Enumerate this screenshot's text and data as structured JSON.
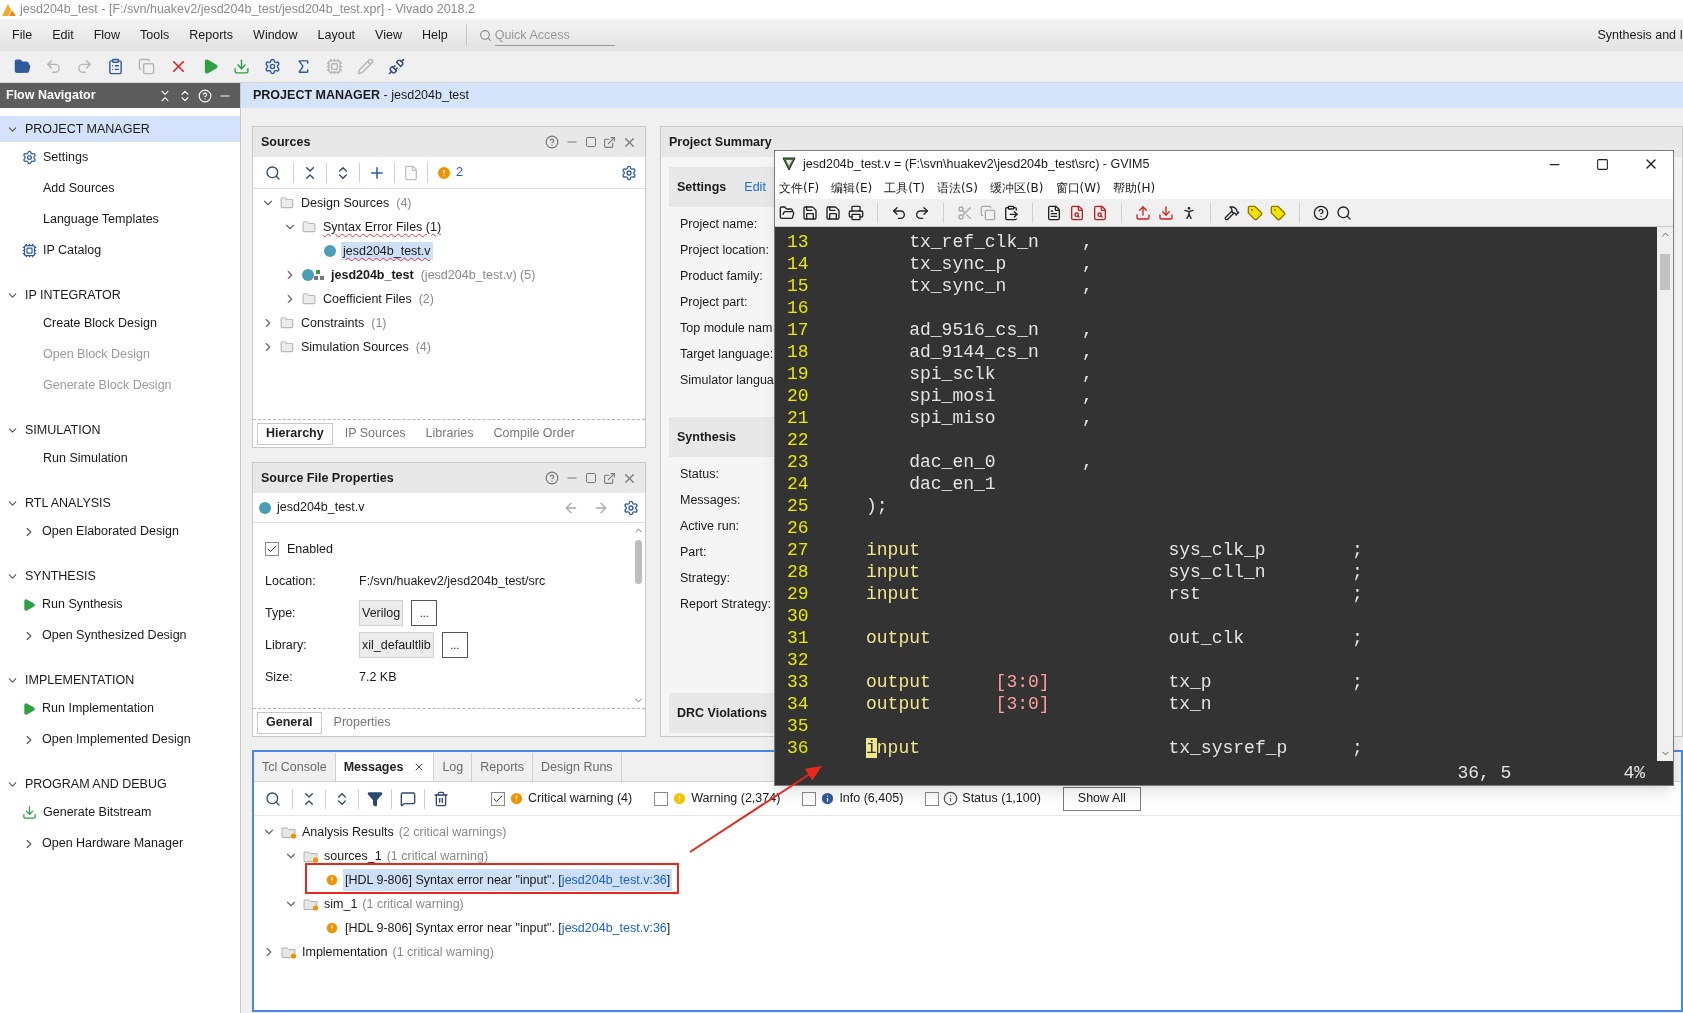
{
  "window": {
    "title": "jesd204b_test - [F:/svn/huakev2/jesd204b_test/jesd204b_test.xpr] - Vivado 2018.2"
  },
  "menu": [
    "File",
    "Edit",
    "Flow",
    "Tools",
    "Reports",
    "Window",
    "Layout",
    "View",
    "Help"
  ],
  "quick_access": {
    "placeholder": "Quick Access"
  },
  "layout_label": "Synthesis and I",
  "flow_navigator": {
    "title": "Flow Navigator",
    "sections": [
      {
        "title": "PROJECT MANAGER",
        "selected": true,
        "expanded": true,
        "items": [
          {
            "label": "Settings",
            "kind": "gear",
            "disabled": false
          },
          {
            "label": "Add Sources",
            "kind": "plain",
            "disabled": false
          },
          {
            "label": "Language Templates",
            "kind": "plain",
            "disabled": false
          },
          {
            "label": "IP Catalog",
            "kind": "catalog",
            "disabled": false
          }
        ]
      },
      {
        "title": "IP INTEGRATOR",
        "selected": false,
        "expanded": true,
        "items": [
          {
            "label": "Create Block Design",
            "kind": "plain",
            "disabled": false
          },
          {
            "label": "Open Block Design",
            "kind": "plain",
            "disabled": true
          },
          {
            "label": "Generate Block Design",
            "kind": "plain",
            "disabled": true
          }
        ]
      },
      {
        "title": "SIMULATION",
        "selected": false,
        "expanded": true,
        "items": [
          {
            "label": "Run Simulation",
            "kind": "plain",
            "disabled": false
          }
        ]
      },
      {
        "title": "RTL ANALYSIS",
        "selected": false,
        "expanded": true,
        "items": [
          {
            "label": "Open Elaborated Design",
            "kind": "expand",
            "disabled": false
          }
        ]
      },
      {
        "title": "SYNTHESIS",
        "selected": false,
        "expanded": true,
        "items": [
          {
            "label": "Run Synthesis",
            "kind": "run",
            "disabled": false
          },
          {
            "label": "Open Synthesized Design",
            "kind": "expand",
            "disabled": false
          }
        ]
      },
      {
        "title": "IMPLEMENTATION",
        "selected": false,
        "expanded": true,
        "items": [
          {
            "label": "Run Implementation",
            "kind": "run",
            "disabled": false
          },
          {
            "label": "Open Implemented Design",
            "kind": "expand",
            "disabled": false
          }
        ]
      },
      {
        "title": "PROGRAM AND DEBUG",
        "selected": false,
        "expanded": true,
        "items": [
          {
            "label": "Generate Bitstream",
            "kind": "bitstream",
            "disabled": false
          },
          {
            "label": "Open Hardware Manager",
            "kind": "expand",
            "disabled": false
          }
        ]
      }
    ]
  },
  "project_manager": {
    "heading": "**PROJECT MANAGER** - jesd204b_test"
  },
  "sources": {
    "title": "Sources",
    "warning_count": "2",
    "tree": [
      {
        "label": "Design Sources",
        "count": "(4)",
        "kind": "folder",
        "expanded": true,
        "selected": false,
        "children": [
          {
            "label": "Syntax Error Files (1)",
            "kind": "folder",
            "expanded": true,
            "selected": false,
            "error": true,
            "children": [
              {
                "label": "jesd204b_test.v",
                "kind": "file",
                "selected": true,
                "error": true
              }
            ]
          },
          {
            "label": "jesd204b_test",
            "detail": "(jesd204b_test.v) (5)",
            "kind": "module",
            "bold": true,
            "expanded": false,
            "selected": false
          },
          {
            "label": "Coefficient Files",
            "count": "(2)",
            "kind": "folder",
            "expanded": false,
            "selected": false
          }
        ]
      },
      {
        "label": "Constraints",
        "count": "(1)",
        "kind": "folder",
        "expanded": false,
        "selected": false
      },
      {
        "label": "Simulation Sources",
        "count": "(4)",
        "kind": "folder",
        "expanded": false,
        "selected": false
      }
    ],
    "tabs": [
      {
        "label": "Hierarchy",
        "selected": true
      },
      {
        "label": "IP Sources",
        "selected": false
      },
      {
        "label": "Libraries",
        "selected": false
      },
      {
        "label": "Compile Order",
        "selected": false
      }
    ]
  },
  "source_file_properties": {
    "title": "Source File Properties",
    "file": "jesd204b_test.v",
    "enabled": {
      "label": "Enabled",
      "checked": true
    },
    "rows": [
      {
        "kind": "text",
        "label": "Location:",
        "value": "F:/svn/huakev2/jesd204b_test/src"
      },
      {
        "kind": "field",
        "label": "Type:",
        "value": "Verilog",
        "button": "..."
      },
      {
        "kind": "field",
        "label": "Library:",
        "value": "xil_defaultlib",
        "button": "..."
      },
      {
        "kind": "text",
        "label": "Size:",
        "value": "7.2 KB"
      }
    ],
    "tabs": [
      {
        "label": "General",
        "selected": true
      },
      {
        "label": "Properties",
        "selected": false
      }
    ]
  },
  "project_summary": {
    "title": "Project Summary",
    "sections": [
      {
        "title": "Settings",
        "link": "Edit",
        "labels": [
          "Project name:",
          "Project location:",
          "Product family:",
          "Project part:",
          "Top module nam",
          "Target language:",
          "Simulator langua"
        ]
      },
      {
        "title": "Synthesis",
        "labels": [
          "Status:",
          "Messages:",
          "Active run:",
          "Part:",
          "Strategy:",
          "Report Strategy:"
        ]
      },
      {
        "title": "DRC Violations"
      }
    ]
  },
  "gvim": {
    "title": "jesd204b_test.v = (F:\\svn\\huakev2\\jesd204b_test\\src) - GVIM5",
    "menu": [
      "文件(F)",
      "编辑(E)",
      "工具(T)",
      "语法(S)",
      "缓冲区(B)",
      "窗口(W)",
      "帮助(H)"
    ],
    "lines": [
      {
        "number": "13",
        "kind": "signal",
        "signal": "tx_ref_clk_n",
        "punct": ","
      },
      {
        "number": "14",
        "kind": "signal",
        "signal": "tx_sync_p",
        "punct": ","
      },
      {
        "number": "15",
        "kind": "signal",
        "signal": "tx_sync_n",
        "punct": ","
      },
      {
        "number": "16",
        "kind": "blank"
      },
      {
        "number": "17",
        "kind": "signal",
        "signal": "ad_9516_cs_n",
        "punct": ","
      },
      {
        "number": "18",
        "kind": "signal",
        "signal": "ad_9144_cs_n",
        "punct": ","
      },
      {
        "number": "19",
        "kind": "signal",
        "signal": "spi_sclk",
        "punct": ","
      },
      {
        "number": "20",
        "kind": "signal",
        "signal": "spi_mosi",
        "punct": ","
      },
      {
        "number": "21",
        "kind": "signal",
        "signal": "spi_miso",
        "punct": ","
      },
      {
        "number": "22",
        "kind": "blank"
      },
      {
        "number": "23",
        "kind": "signal",
        "signal": "dac_en_0",
        "punct": ","
      },
      {
        "number": "24",
        "kind": "signal",
        "signal": "dac_en_1"
      },
      {
        "number": "25",
        "kind": "close",
        "text": ");"
      },
      {
        "number": "26",
        "kind": "blank"
      },
      {
        "number": "27",
        "kind": "port",
        "keyword": "input",
        "signal": "sys_clk_p",
        "punct": ";"
      },
      {
        "number": "28",
        "kind": "port",
        "keyword": "input",
        "signal": "sys_cll_n",
        "punct": ";"
      },
      {
        "number": "29",
        "kind": "port",
        "keyword": "input",
        "signal": "rst",
        "punct": ";"
      },
      {
        "number": "30",
        "kind": "blank"
      },
      {
        "number": "31",
        "kind": "port",
        "keyword": "output",
        "signal": "out_clk",
        "punct": ";"
      },
      {
        "number": "32",
        "kind": "blank"
      },
      {
        "number": "33",
        "kind": "port",
        "keyword": "output",
        "range": "[3:0]",
        "signal": "tx_p",
        "punct": ";"
      },
      {
        "number": "34",
        "kind": "port",
        "keyword": "output",
        "range": "[3:0]",
        "signal": "tx_n"
      },
      {
        "number": "35",
        "kind": "blank"
      },
      {
        "number": "36",
        "kind": "port",
        "keyword": "input",
        "signal": "tx_sysref_p",
        "punct": ";",
        "cursor": true
      }
    ],
    "position": "36, 5",
    "percent": "4%"
  },
  "messages": {
    "tabs": [
      {
        "label": "Tcl Console",
        "selected": false
      },
      {
        "label": "Messages",
        "selected": true,
        "closable": true
      },
      {
        "label": "Log",
        "selected": false
      },
      {
        "label": "Reports",
        "selected": false
      },
      {
        "label": "Design Runs",
        "selected": false
      }
    ],
    "filters": [
      {
        "label": "Critical warning (4)",
        "checked": true,
        "kind": "critical"
      },
      {
        "label": "Warning (2,374)",
        "checked": false,
        "kind": "warning"
      },
      {
        "label": "Info (6,405)",
        "checked": false,
        "kind": "info"
      },
      {
        "label": "Status (1,100)",
        "checked": false,
        "kind": "status"
      }
    ],
    "show_all": "Show All",
    "tree": [
      {
        "kind": "group",
        "label": "Analysis Results",
        "count": "(2 critical warnings)",
        "expanded": true,
        "selected": false,
        "children": [
          {
            "kind": "group",
            "label": "sources_1",
            "count": "(1 critical warning)",
            "expanded": true,
            "selected": false,
            "children": [
              {
                "kind": "message",
                "text_before": "[HDL 9-806] Syntax error near \"input\". [",
                "link": "jesd204b_test.v:36",
                "text_after": "]",
                "selected": true,
                "annotated": true
              }
            ]
          },
          {
            "kind": "group",
            "label": "sim_1",
            "count": "(1 critical warning)",
            "expanded": true,
            "selected": false,
            "children": [
              {
                "kind": "message",
                "text_before": "[HDL 9-806] Syntax error near \"input\". [",
                "link": "jesd204b_test.v:36",
                "text_after": "]",
                "selected": false,
                "annotated": false
              }
            ]
          }
        ]
      },
      {
        "kind": "group",
        "label": "Implementation",
        "count": "(1 critical warning)",
        "expanded": false,
        "selected": false
      }
    ]
  },
  "callout_arrow": true
}
